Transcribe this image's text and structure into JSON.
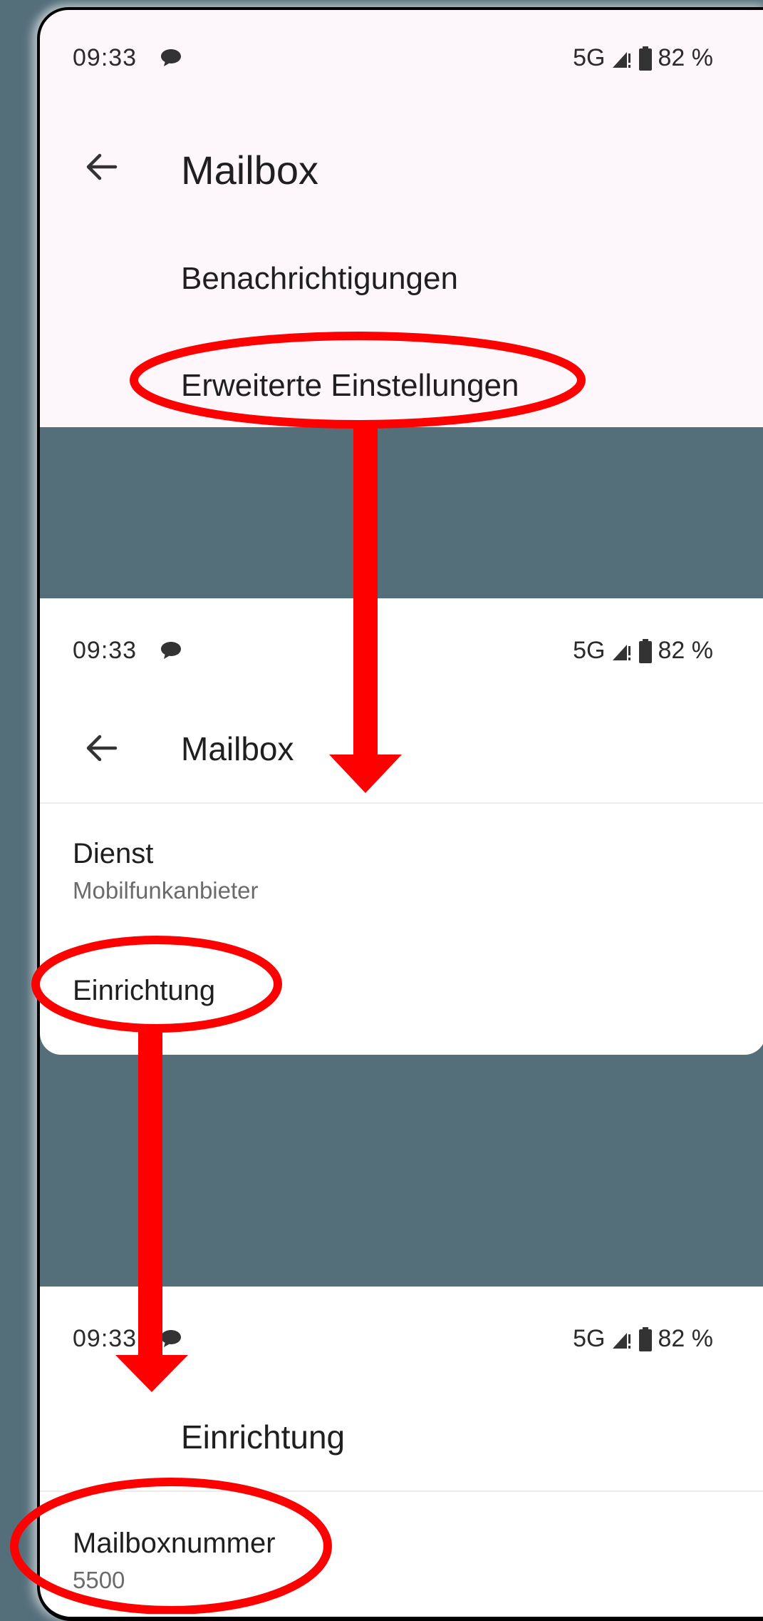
{
  "status_bar": {
    "time": "09:33",
    "network": "5G",
    "battery": "82 %"
  },
  "screen1": {
    "title": "Mailbox",
    "items": [
      "Benachrichtigungen",
      "Erweiterte Einstellungen"
    ]
  },
  "screen2": {
    "title": "Mailbox",
    "service_label": "Dienst",
    "service_value": "Mobilfunkanbieter",
    "setup_label": "Einrichtung"
  },
  "screen3": {
    "title": "Einrichtung",
    "number_label": "Mailboxnummer",
    "number_value": "5500"
  },
  "colors": {
    "highlight": "#ff0000",
    "backdrop": "#546e7a"
  },
  "icons": [
    "chat-bubble-icon",
    "signal-icon",
    "battery-icon",
    "back-arrow-icon"
  ]
}
